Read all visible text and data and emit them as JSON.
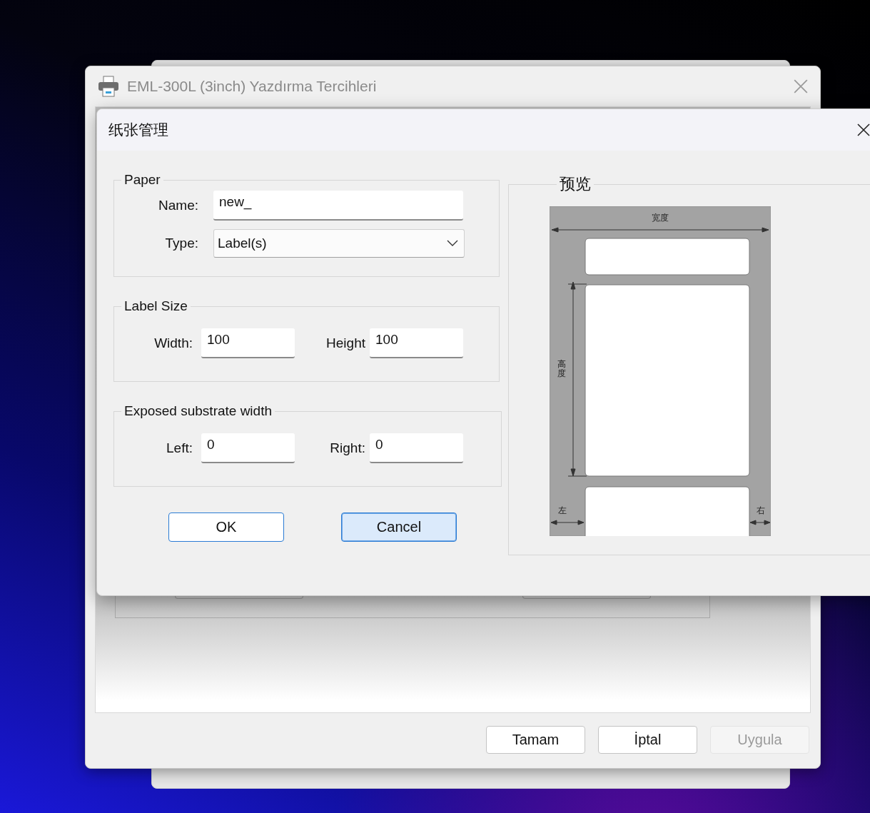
{
  "window": {
    "title": "EML-300L (3inch) Yazdırma Tercihleri",
    "buttons": [
      {
        "label": "Tamam",
        "disabled": false
      },
      {
        "label": "İptal",
        "disabled": false
      },
      {
        "label": "Uygula",
        "disabled": true
      }
    ]
  },
  "dialog": {
    "title": "纸张管理",
    "groups": [
      {
        "title": "Paper",
        "kind": "stacked",
        "fields": [
          {
            "label": "Name:",
            "value": "new_",
            "kind": "text"
          },
          {
            "label": "Type:",
            "value": "Label(s)",
            "kind": "dropdown"
          }
        ]
      },
      {
        "title": "Label Size",
        "kind": "pair",
        "fields": [
          {
            "label": "Width:",
            "value": "100",
            "kind": "text"
          },
          {
            "label": "Height",
            "value": "100",
            "kind": "text"
          }
        ]
      },
      {
        "title": "Exposed substrate width",
        "kind": "pair",
        "fields": [
          {
            "label": "Left:",
            "value": "0",
            "kind": "text"
          },
          {
            "label": "Right:",
            "value": "0",
            "kind": "text"
          }
        ]
      }
    ],
    "buttons": [
      {
        "label": "OK",
        "focused": false
      },
      {
        "label": "Cancel",
        "focused": true
      }
    ],
    "preview": {
      "title": "预览",
      "width_label": "宽度",
      "height_label": "高度",
      "left_label": "左",
      "right_label": "右"
    }
  }
}
